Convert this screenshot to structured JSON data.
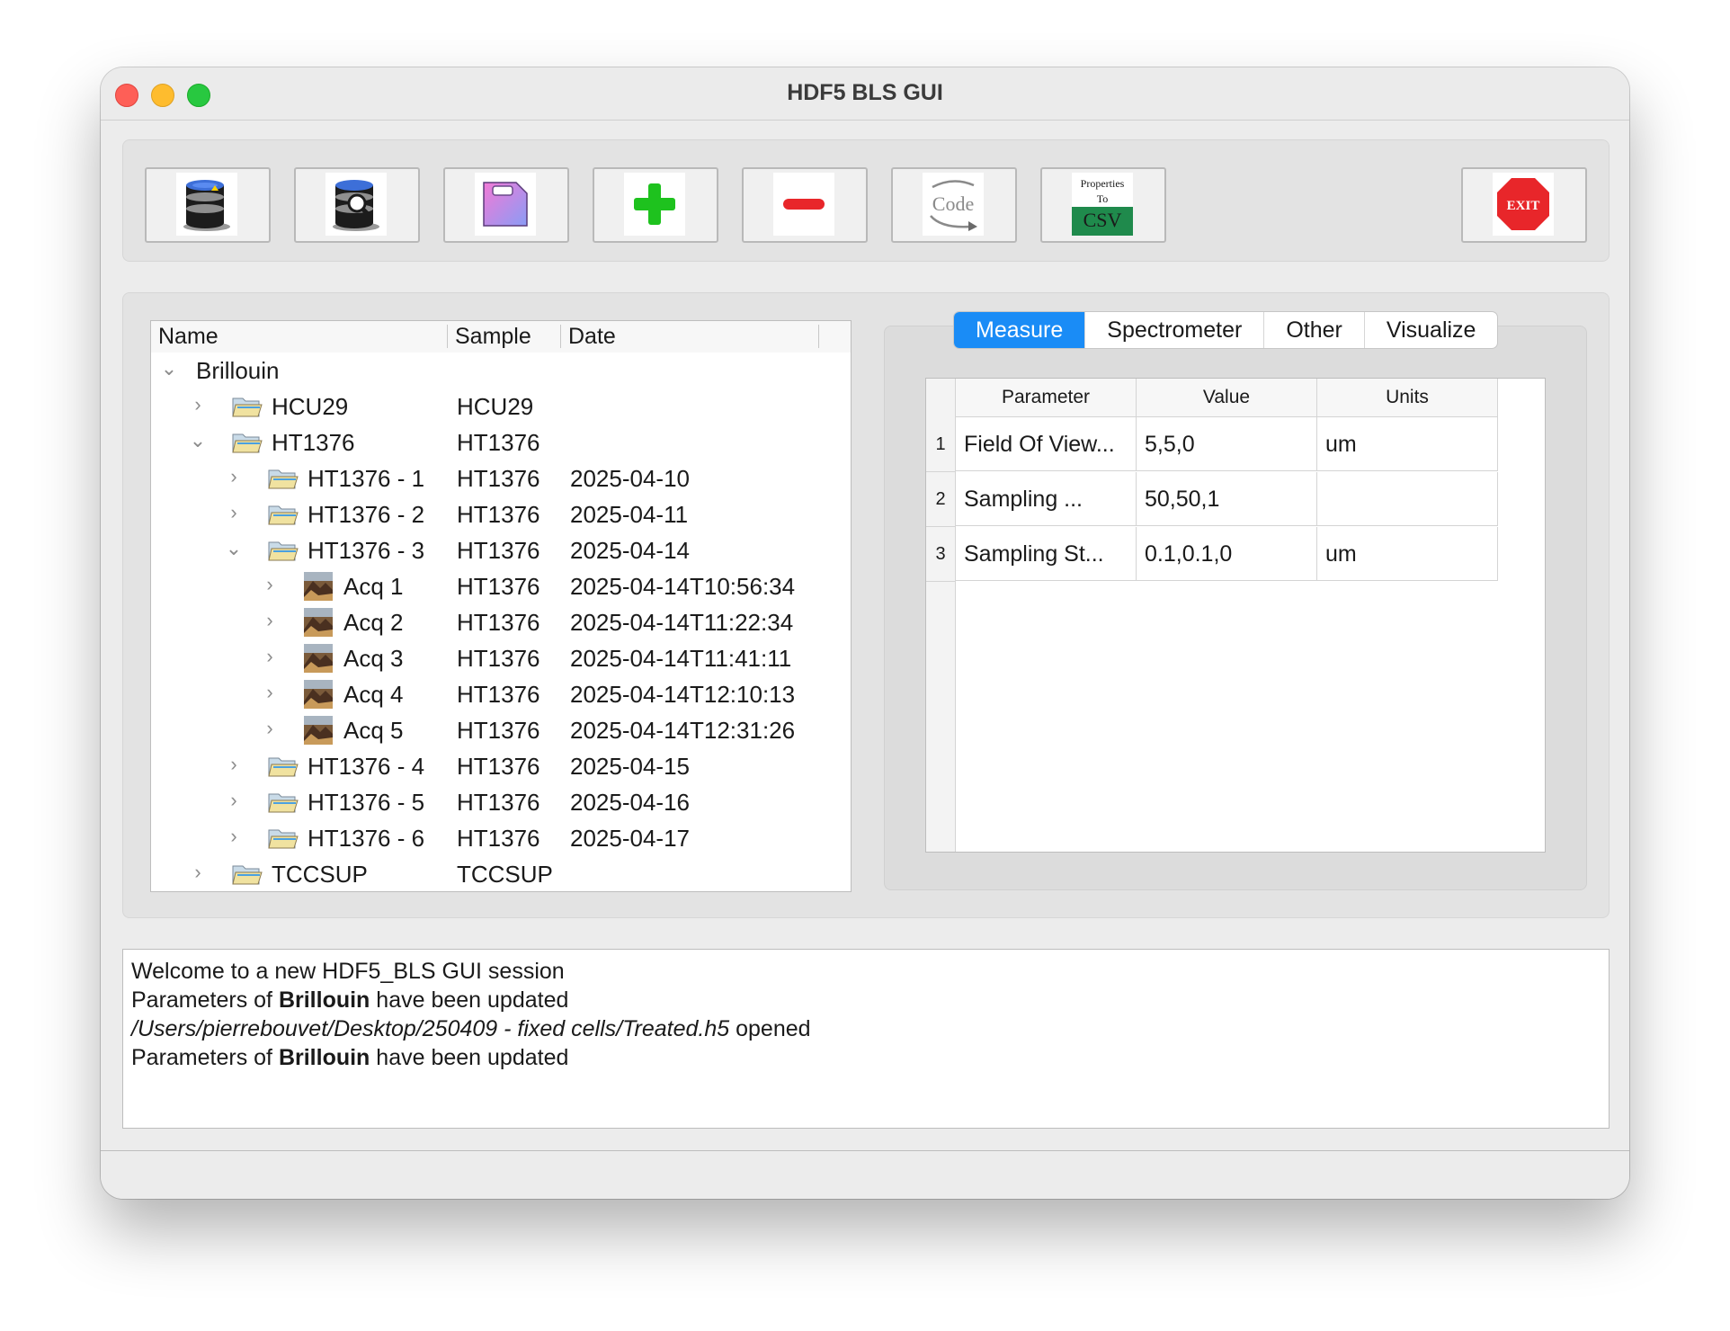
{
  "window": {
    "title": "HDF5 BLS GUI"
  },
  "toolbar": {
    "buttons": [
      {
        "name": "open-database-button",
        "icon": "database-open-icon"
      },
      {
        "name": "inspect-database-button",
        "icon": "database-search-icon"
      },
      {
        "name": "save-file-button",
        "icon": "file-icon"
      },
      {
        "name": "add-button",
        "icon": "plus-icon"
      },
      {
        "name": "remove-button",
        "icon": "minus-icon"
      },
      {
        "name": "export-code-button",
        "icon": "code-arrow-icon",
        "label": "Code"
      },
      {
        "name": "properties-to-csv-button",
        "icon": "csv-icon",
        "label_line1": "Properties",
        "label_line2": "To",
        "label_line3": "CSV"
      },
      {
        "name": "exit-button",
        "icon": "exit-stop-icon",
        "label": "EXIT"
      }
    ]
  },
  "tree": {
    "headers": {
      "name": "Name",
      "sample": "Sample",
      "date": "Date"
    },
    "rows": [
      {
        "name": "Brillouin",
        "sample": "",
        "date": "",
        "expanded": true,
        "icon": "none"
      },
      {
        "name": "HCU29",
        "sample": "HCU29",
        "date": "",
        "expanded": false,
        "icon": "folder-icon"
      },
      {
        "name": "HT1376",
        "sample": "HT1376",
        "date": "",
        "expanded": true,
        "icon": "folder-icon"
      },
      {
        "name": "HT1376 - 1",
        "sample": "HT1376",
        "date": "2025-04-10",
        "expanded": false,
        "icon": "folder-icon"
      },
      {
        "name": "HT1376 - 2",
        "sample": "HT1376",
        "date": "2025-04-11",
        "expanded": false,
        "icon": "folder-icon"
      },
      {
        "name": "HT1376 - 3",
        "sample": "HT1376",
        "date": "2025-04-14",
        "expanded": true,
        "icon": "folder-icon"
      },
      {
        "name": "Acq 1",
        "sample": "HT1376",
        "date": "2025-04-14T10:56:34",
        "expanded": false,
        "icon": "image-icon"
      },
      {
        "name": "Acq 2",
        "sample": "HT1376",
        "date": "2025-04-14T11:22:34",
        "expanded": false,
        "icon": "image-icon"
      },
      {
        "name": "Acq 3",
        "sample": "HT1376",
        "date": "2025-04-14T11:41:11",
        "expanded": false,
        "icon": "image-icon"
      },
      {
        "name": "Acq 4",
        "sample": "HT1376",
        "date": "2025-04-14T12:10:13",
        "expanded": false,
        "icon": "image-icon"
      },
      {
        "name": "Acq 5",
        "sample": "HT1376",
        "date": "2025-04-14T12:31:26",
        "expanded": false,
        "icon": "image-icon"
      },
      {
        "name": "HT1376 - 4",
        "sample": "HT1376",
        "date": "2025-04-15",
        "expanded": false,
        "icon": "folder-icon"
      },
      {
        "name": "HT1376 - 5",
        "sample": "HT1376",
        "date": "2025-04-16",
        "expanded": false,
        "icon": "folder-icon"
      },
      {
        "name": "HT1376 - 6",
        "sample": "HT1376",
        "date": "2025-04-17",
        "expanded": false,
        "icon": "folder-icon"
      },
      {
        "name": "TCCSUP",
        "sample": "TCCSUP",
        "date": "",
        "expanded": false,
        "icon": "folder-icon"
      }
    ]
  },
  "tabs": {
    "items": [
      "Measure",
      "Spectrometer",
      "Other",
      "Visualize"
    ],
    "active": "Measure"
  },
  "params_table": {
    "headers": [
      "Parameter",
      "Value",
      "Units"
    ],
    "rows": [
      {
        "num": "1",
        "parameter": "Field Of View...",
        "value": "5,5,0",
        "units": "um"
      },
      {
        "num": "2",
        "parameter": "Sampling ...",
        "value": "50,50,1",
        "units": ""
      },
      {
        "num": "3",
        "parameter": "Sampling St...",
        "value": "0.1,0.1,0",
        "units": "um"
      }
    ]
  },
  "log": {
    "line1": "Welcome to a new HDF5_BLS GUI session",
    "line2_prefix": "Parameters of ",
    "line2_bold": "Brillouin",
    "line2_suffix": " have been updated",
    "line3_path": "/Users/pierrebouvet/Desktop/250409 - fixed cells/Treated.h5",
    "line3_suffix": " opened",
    "line4_prefix": "Parameters of ",
    "line4_bold": "Brillouin",
    "line4_suffix": " have been updated"
  },
  "colors": {
    "accent": "#1a8cf6",
    "exit_red": "#e8262a",
    "plus_green": "#1ec21e",
    "minus_red": "#e8262a"
  }
}
